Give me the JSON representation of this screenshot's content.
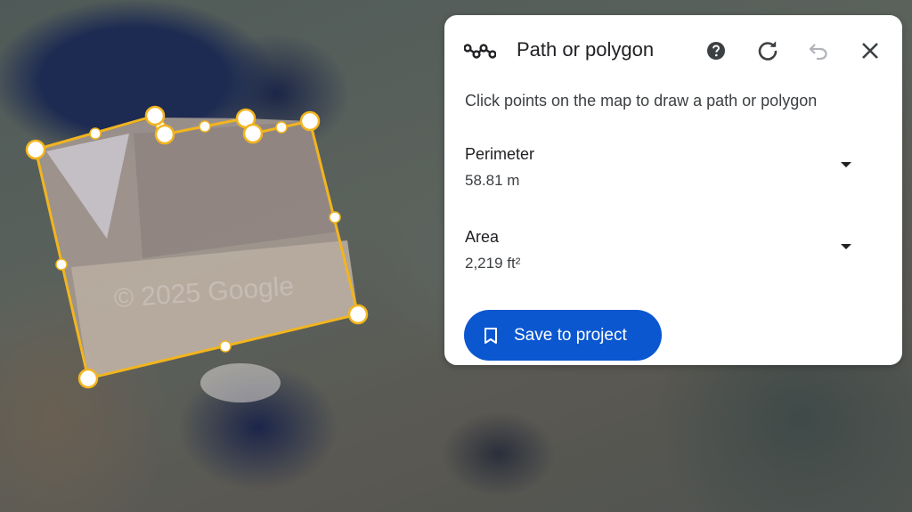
{
  "map": {
    "watermark": "© 2025 Google",
    "outline_color": "#f2b51f",
    "measurement_polygon": "measurement-polygon"
  },
  "panel": {
    "title": "Path or polygon",
    "title_icon": "path-polygon-icon",
    "actions": {
      "help": "help-icon",
      "refresh": "refresh-icon",
      "undo": "undo-icon",
      "close": "close-icon"
    },
    "instruction": "Click points on the map to draw a path or polygon",
    "perimeter": {
      "label": "Perimeter",
      "value": "58.81 m"
    },
    "area": {
      "label": "Area",
      "value": "2,219 ft²"
    },
    "save_button": {
      "label": "Save to project",
      "icon": "bookmark-icon",
      "color": "#0b57d0"
    }
  }
}
